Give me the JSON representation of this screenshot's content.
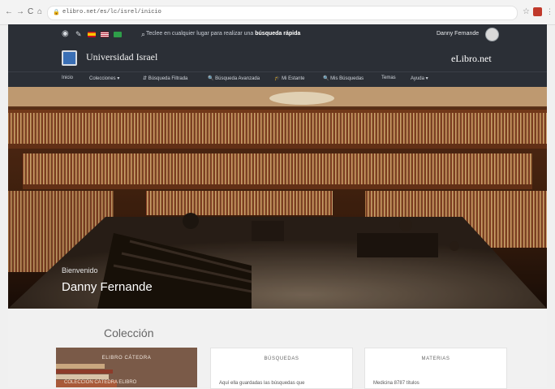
{
  "browser": {
    "url": "elibro.net/es/lc/isrel/inicio",
    "back_glyph": "←",
    "forward_glyph": "→",
    "reload_glyph": "C",
    "home_glyph": "⌂"
  },
  "topbar": {
    "icons": [
      "globe-icon",
      "pencil-icon",
      "flag-es-icon",
      "flag-us-icon",
      "flag-br-icon"
    ],
    "search_glyph": "🔍",
    "quick_search_prefix": "Teclee en cualquier lugar para realizar una ",
    "quick_search_bold": "búsqueda rápida",
    "user_name": "Danny Fernande"
  },
  "brand": {
    "institution": "Universidad Israel",
    "product": "eLibro.net"
  },
  "nav": {
    "items": [
      "Inicio",
      "Colecciones  ▾",
      "⇵ Búsqueda Filtrada",
      "🔍 Búsqueda Avanzada",
      "🎓 Mi Estante",
      "🔍 Mis Búsquedas",
      "Temas",
      "Ayuda  ▾"
    ]
  },
  "hero": {
    "welcome": "Bienvenido",
    "name": "Danny Fernande"
  },
  "content": {
    "section_title": "Colección",
    "cards": [
      {
        "title": "ELIBRO CÁTEDRA",
        "text": "COLECCIÓN CÁTEDRA ELIBRO"
      },
      {
        "title": "BÚSQUEDAS",
        "text": "Aquí ella guardadas las búsquedas que"
      },
      {
        "title": "MATERIAS",
        "text": "Medicina  8787 títulos"
      }
    ]
  },
  "colors": {
    "header_bg": "#2b2f36",
    "content_bg": "#f1f1f1",
    "hero_wood": "#6b3a1f"
  }
}
